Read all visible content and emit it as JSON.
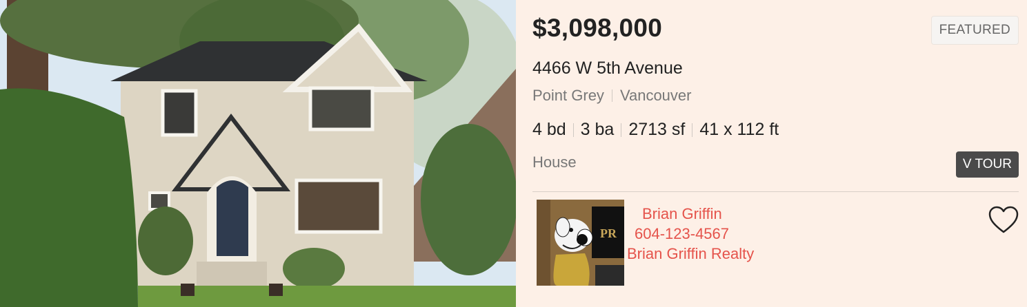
{
  "listing": {
    "price": "$3,098,000",
    "badge": "FEATURED",
    "address": "4466 W 5th Avenue",
    "neighbourhood": "Point Grey",
    "city": "Vancouver",
    "beds": "4 bd",
    "baths": "3 ba",
    "sqft": "2713 sf",
    "lot": "41 x 112 ft",
    "property_type": "House",
    "tour_label": "V TOUR"
  },
  "agent": {
    "name": "Brian Griffin",
    "phone": "604-123-4567",
    "company": "Brian Griffin Realty"
  },
  "colors": {
    "panel_bg": "#fdf0e7",
    "agent_text": "#e5534b",
    "tour_bg": "#4a4a4a"
  },
  "icons": {
    "favorite": "heart-outline-icon"
  }
}
